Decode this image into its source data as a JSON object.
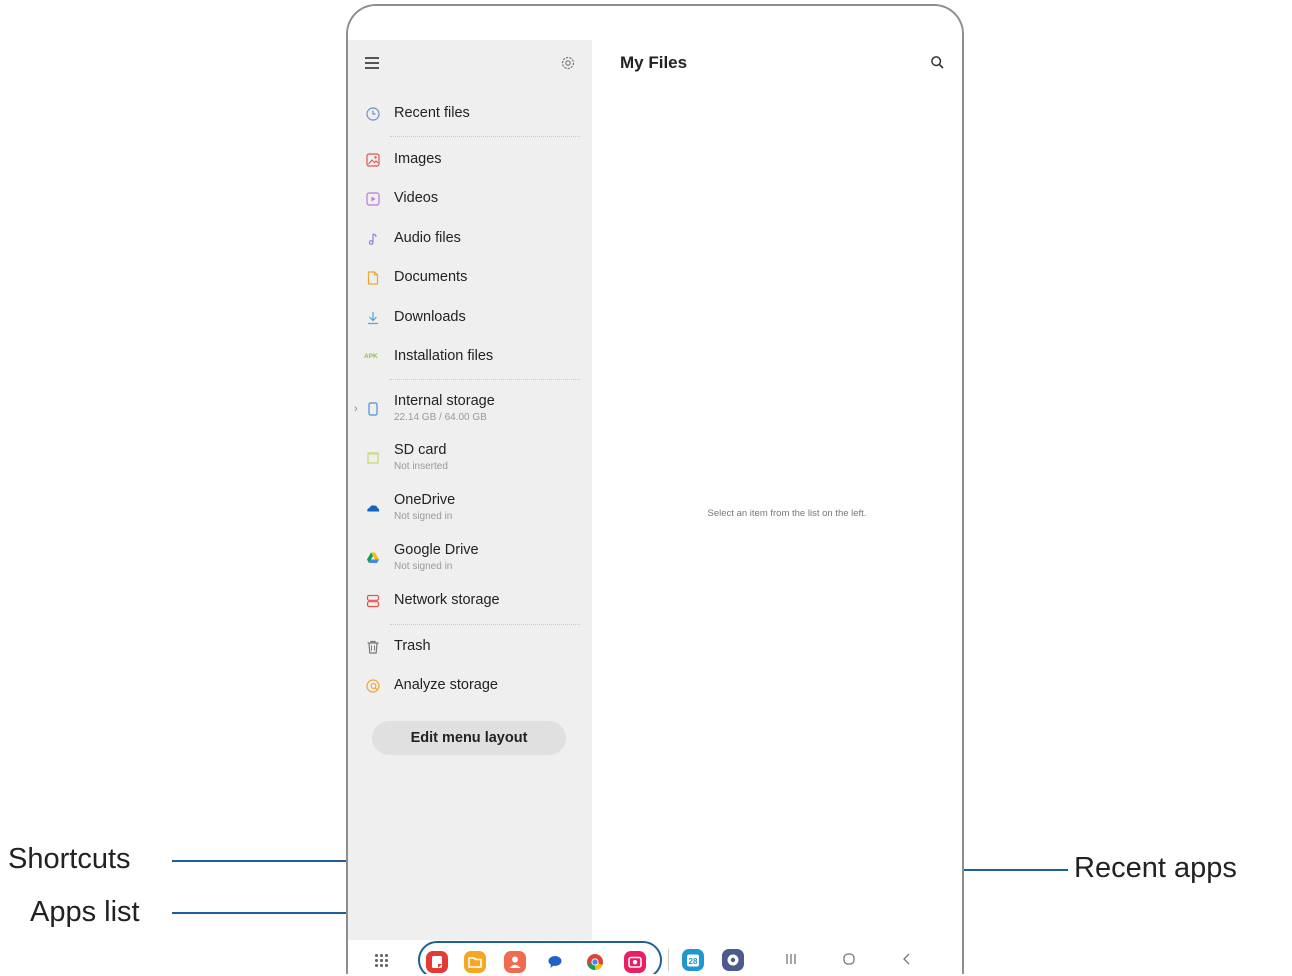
{
  "drawer": {
    "items": [
      {
        "label": "Recent files",
        "icon": "clock-icon"
      },
      {
        "label": "Images",
        "icon": "image-icon"
      },
      {
        "label": "Videos",
        "icon": "video-icon"
      },
      {
        "label": "Audio files",
        "icon": "music-note-icon"
      },
      {
        "label": "Documents",
        "icon": "document-icon"
      },
      {
        "label": "Downloads",
        "icon": "download-icon"
      },
      {
        "label": "Installation files",
        "icon": "apk-icon",
        "icon_text": "APK"
      },
      {
        "label": "Internal storage",
        "sub": "22.14 GB / 64.00 GB",
        "icon": "phone-icon"
      },
      {
        "label": "SD card",
        "sub": "Not inserted",
        "icon": "sd-card-icon"
      },
      {
        "label": "OneDrive",
        "sub": "Not signed in",
        "icon": "onedrive-icon"
      },
      {
        "label": "Google Drive",
        "sub": "Not signed in",
        "icon": "google-drive-icon"
      },
      {
        "label": "Network storage",
        "icon": "network-storage-icon"
      },
      {
        "label": "Trash",
        "icon": "trash-icon"
      },
      {
        "label": "Analyze storage",
        "icon": "analyze-storage-icon"
      }
    ],
    "edit_button": "Edit menu layout"
  },
  "main": {
    "title": "My Files",
    "empty_message": "Select an item from the list on the left."
  },
  "taskbar": {
    "shortcuts": [
      "notes-icon",
      "my-files-icon",
      "contacts-icon",
      "messages-icon",
      "chrome-icon",
      "screen-recorder-icon"
    ],
    "recent_apps": [
      "calendar-icon",
      "settings-app-icon"
    ],
    "calendar_day": "28",
    "nav": [
      "recents-nav-icon",
      "home-nav-icon",
      "back-nav-icon"
    ]
  },
  "callouts": {
    "shortcuts": "Shortcuts",
    "apps_list": "Apps list",
    "recent_apps": "Recent apps"
  },
  "colors": {
    "accent": "#1f5f96",
    "drawer_bg": "#efefef"
  }
}
